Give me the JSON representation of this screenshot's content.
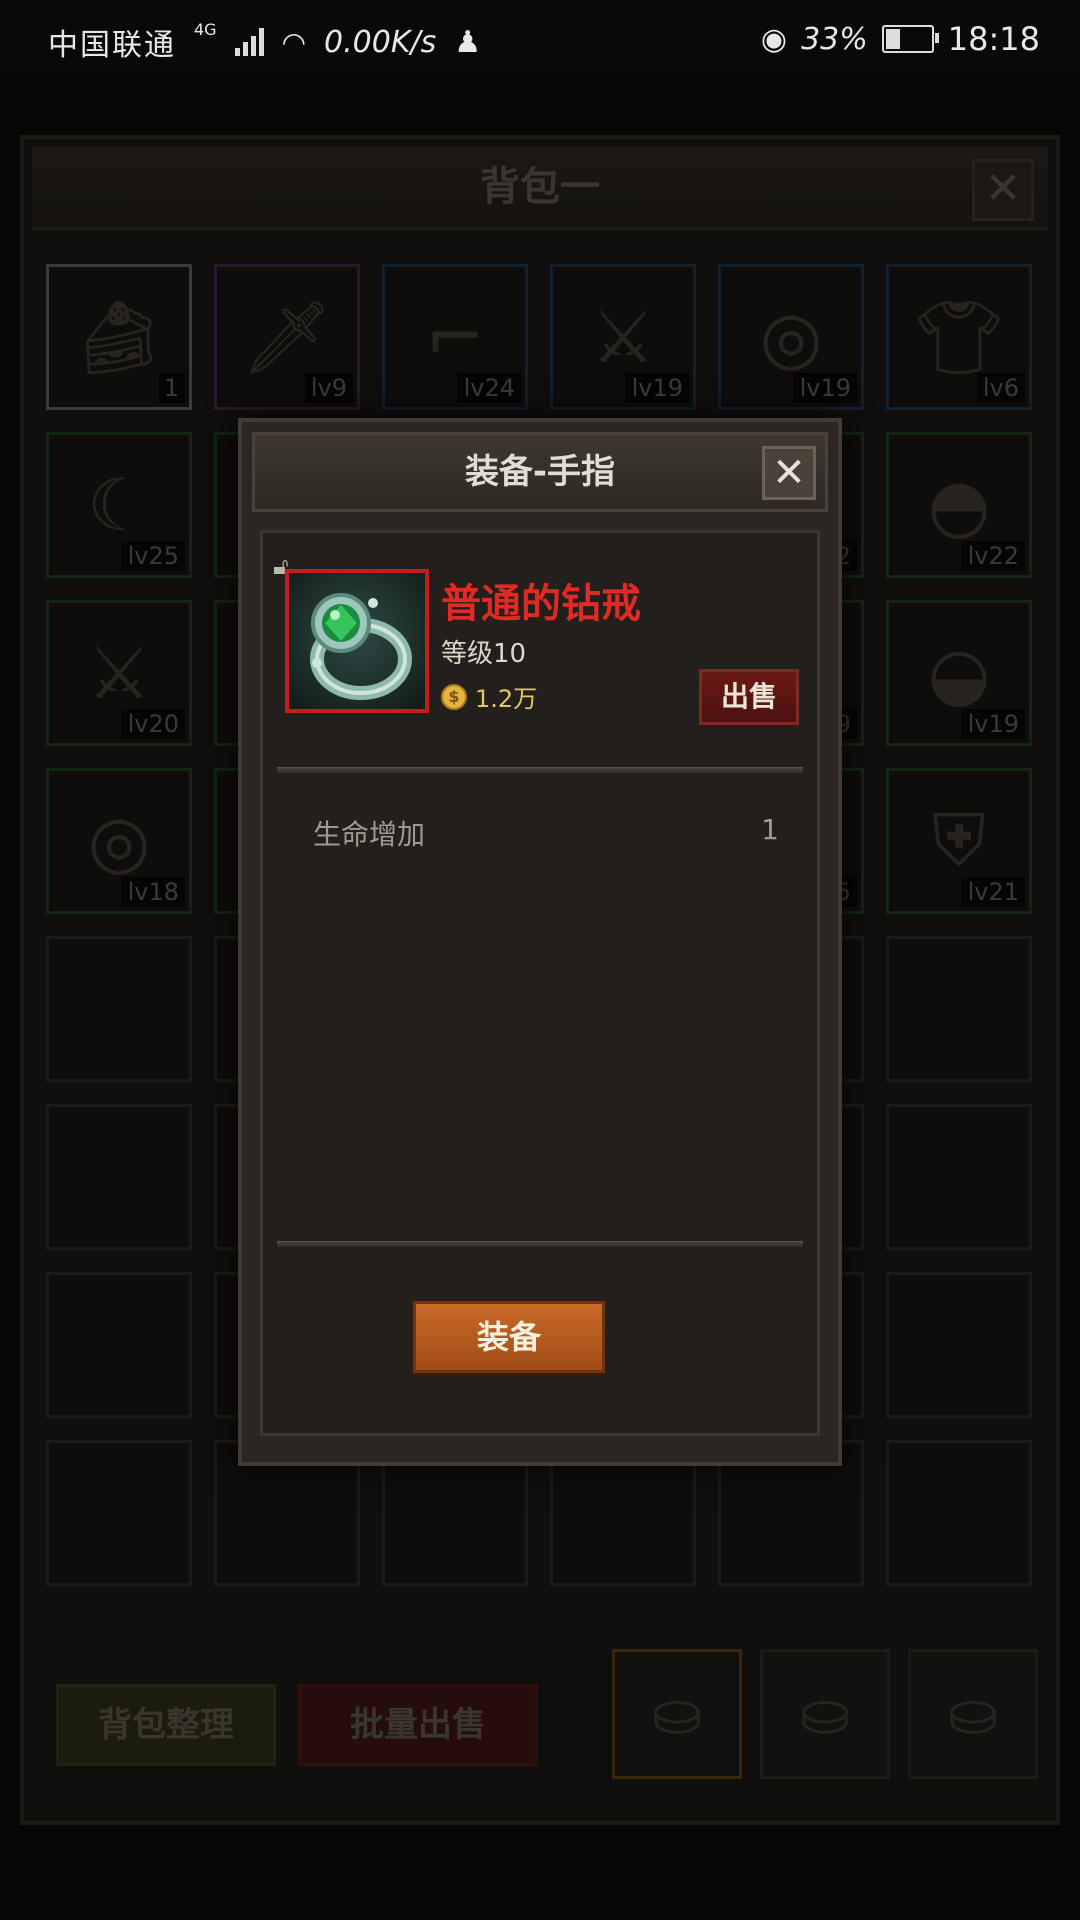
{
  "status_bar": {
    "carrier": "中国联通",
    "network": "4G",
    "speed": "0.00K/s",
    "battery_percent": "33%",
    "time": "18:18"
  },
  "bag": {
    "title": "背包一",
    "close_label": "✕",
    "sort_label": "背包整理",
    "bulk_sell_label": "批量出售",
    "slots": [
      {
        "label": "1",
        "icon": "cake-icon",
        "rarity": "white"
      },
      {
        "label": "lv9",
        "icon": "dagger-icon",
        "rarity": "purple"
      },
      {
        "label": "lv24",
        "icon": "pistol-icon",
        "rarity": "blue"
      },
      {
        "label": "lv19",
        "icon": "sword-icon",
        "rarity": "blue"
      },
      {
        "label": "lv19",
        "icon": "shield-icon",
        "rarity": "blue"
      },
      {
        "label": "lv6",
        "icon": "shirt-icon",
        "rarity": "blue"
      },
      {
        "label": "lv25",
        "icon": "scimitar-icon",
        "rarity": "green"
      },
      {
        "label": "",
        "icon": "",
        "rarity": "green"
      },
      {
        "label": "",
        "icon": "",
        "rarity": "green"
      },
      {
        "label": "",
        "icon": "",
        "rarity": "green"
      },
      {
        "label": "2",
        "icon": "",
        "rarity": "green"
      },
      {
        "label": "lv22",
        "icon": "helmet-icon",
        "rarity": "green"
      },
      {
        "label": "lv20",
        "icon": "sword-icon",
        "rarity": "green"
      },
      {
        "label": "",
        "icon": "",
        "rarity": "green"
      },
      {
        "label": "",
        "icon": "",
        "rarity": "green"
      },
      {
        "label": "",
        "icon": "",
        "rarity": "green"
      },
      {
        "label": "9",
        "icon": "",
        "rarity": "green"
      },
      {
        "label": "lv19",
        "icon": "leather-helmet-icon",
        "rarity": "green"
      },
      {
        "label": "lv18",
        "icon": "shield-icon",
        "rarity": "green"
      },
      {
        "label": "",
        "icon": "",
        "rarity": "green"
      },
      {
        "label": "",
        "icon": "",
        "rarity": "green"
      },
      {
        "label": "",
        "icon": "",
        "rarity": "green"
      },
      {
        "label": "5",
        "icon": "",
        "rarity": "green"
      },
      {
        "label": "lv21",
        "icon": "armor-icon",
        "rarity": "green"
      }
    ]
  },
  "modal": {
    "title": "装备-手指",
    "close_label": "✕",
    "item_name": "普通的钻戒",
    "item_level": "等级10",
    "item_price": "1.2万",
    "coin_symbol": "$",
    "sell_label": "出售",
    "stats": [
      {
        "name": "生命增加",
        "value": "1"
      }
    ],
    "equip_label": "装备",
    "item_icon": "ring-icon",
    "lock_icon": "lock-icon"
  },
  "colors": {
    "item_name": "#e02a24",
    "frame_border": "#c21e1e",
    "equip_button": "#b85a20",
    "sell_button": "#5a1613"
  }
}
